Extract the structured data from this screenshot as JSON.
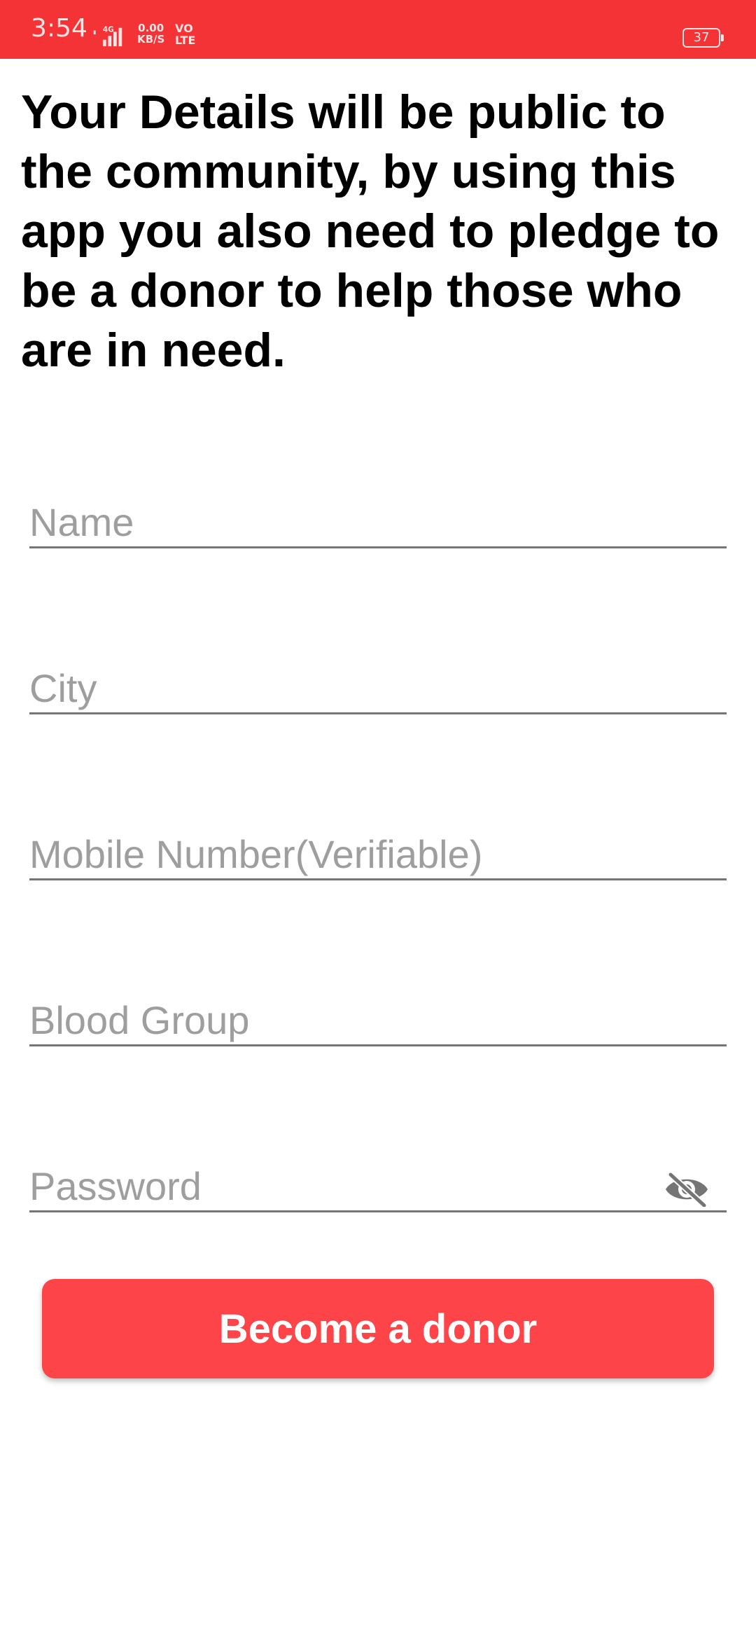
{
  "status_bar": {
    "time": "3:54",
    "network_type": "4G",
    "data_speed_value": "0.00",
    "data_speed_unit": "KB/S",
    "volte_top": "VO",
    "volte_bottom": "LTE",
    "battery_level": "37",
    "background_color": "#f43336"
  },
  "headline": "Your Details will be public to the community, by using this app you also need to pledge to be a donor to help those who are in need.",
  "form": {
    "name_placeholder": "Name",
    "city_placeholder": "City",
    "mobile_placeholder": "Mobile Number(Verifiable)",
    "blood_group_placeholder": "Blood Group",
    "password_placeholder": "Password",
    "password_toggle_icon": "eye-off-icon"
  },
  "submit_button": {
    "label": "Become a donor",
    "color": "#fd4448"
  }
}
